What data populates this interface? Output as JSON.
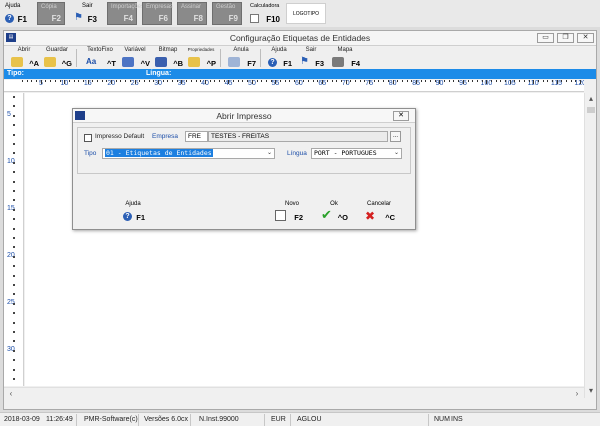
{
  "top_toolbar": {
    "buttons": [
      {
        "label": "Ajuda",
        "key": "F1",
        "enabled": true
      },
      {
        "label": "Cópia",
        "key": "F2",
        "enabled": false
      },
      {
        "label": "Sair",
        "key": "F3",
        "enabled": true
      },
      {
        "label": "Importações",
        "key": "F4",
        "enabled": false
      },
      {
        "label": "Empresas",
        "key": "F6",
        "enabled": false
      },
      {
        "label": "Assinar",
        "key": "F8",
        "enabled": false
      },
      {
        "label": "Gestão",
        "key": "F9",
        "enabled": false
      },
      {
        "label": "Calculadora",
        "key": "F10",
        "enabled": true
      }
    ],
    "logo_text": "LOGOTIPO"
  },
  "window": {
    "title": "Configuração Etiquetas de Entidades",
    "controls": {
      "minimize": "▭",
      "restore": "❐",
      "close": "✕"
    },
    "tools": [
      {
        "label": "Abrir",
        "key": "^A"
      },
      {
        "label": "Guardar",
        "key": "^G"
      },
      {
        "label": "TextoFixo",
        "key": "^T"
      },
      {
        "label": "Variável",
        "key": "^V"
      },
      {
        "label": "Bitmap",
        "key": "^B"
      },
      {
        "label": "Propriedades",
        "key": "^P"
      },
      {
        "label": "Anula",
        "key": "F7"
      },
      {
        "label": "Ajuda",
        "key": "F1"
      },
      {
        "label": "Sair",
        "key": "F3"
      },
      {
        "label": "Mapa",
        "key": "F4"
      }
    ],
    "info_bar": {
      "tipo_label": "Tipo:",
      "lingua_label": "Língua:"
    },
    "ruler_top": [
      "5",
      "10",
      "15",
      "20",
      "25",
      "30",
      "35",
      "40",
      "45",
      "50",
      "55",
      "60",
      "65",
      "70",
      "75",
      "80",
      "85",
      "90",
      "95",
      "100",
      "105",
      "110",
      "115",
      "120"
    ],
    "ruler_left": [
      "5",
      "10",
      "15",
      "20",
      "25",
      "30"
    ]
  },
  "dialog": {
    "title": "Abrir Impresso",
    "impresso_default_label": "Impresso Default",
    "impresso_default_checked": false,
    "empresa_label": "Empresa",
    "empresa_code": "FRE",
    "empresa_name": "TESTES - FREITAS",
    "browse_label": "...",
    "tipo_label": "Tipo",
    "tipo_value": "01 - Etiquetas de Entidades",
    "lingua_label": "Língua",
    "lingua_value": "PORT - PORTUGUES",
    "buttons": [
      {
        "label": "Ajuda",
        "key": "F1"
      },
      {
        "label": "Novo",
        "key": "F2"
      },
      {
        "label": "Ok",
        "key": "^O"
      },
      {
        "label": "Cancelar",
        "key": "^C"
      }
    ]
  },
  "status_bar": {
    "date": "2018-03-09",
    "time": "11:26:49",
    "company": "PMR-Software(c)",
    "version": "Versões 6.0cx",
    "inst": "N.Inst.99000",
    "currency": "EUR",
    "user": "AGLOU",
    "num": "NUM",
    "ins": "INS"
  }
}
